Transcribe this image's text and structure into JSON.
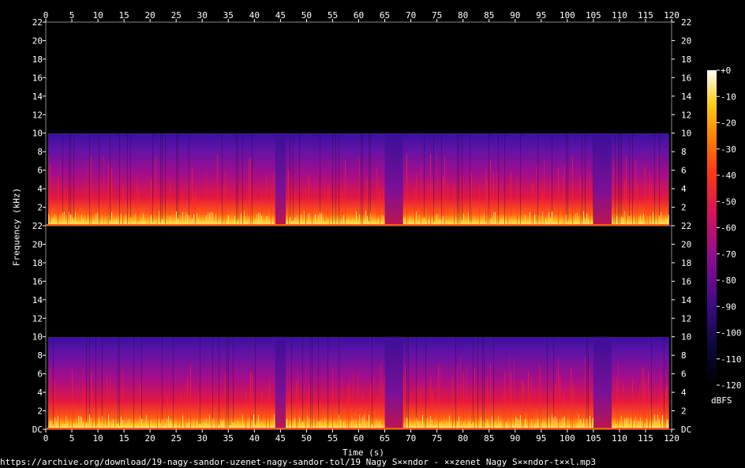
{
  "chart_data": {
    "type": "heatmap",
    "subtype": "spectrogram",
    "channels": 2,
    "xlabel": "Time (s)",
    "ylabel": "Frequency (kHz)",
    "xlim": [
      0,
      120
    ],
    "ylim_khz": [
      0,
      22
    ],
    "x_ticks": [
      "0",
      "5",
      "10",
      "15",
      "20",
      "25",
      "30",
      "35",
      "40",
      "45",
      "50",
      "55",
      "60",
      "65",
      "70",
      "75",
      "80",
      "85",
      "90",
      "95",
      "100",
      "105",
      "110",
      "115",
      "120"
    ],
    "y_ticks_top": [
      "22",
      "20",
      "18",
      "16",
      "14",
      "12",
      "10",
      "8",
      "6",
      "4",
      "2"
    ],
    "y_ticks_bottom": [
      "22",
      "20",
      "18",
      "16",
      "14",
      "12",
      "10",
      "8",
      "6",
      "4",
      "2",
      "DC"
    ],
    "content_cutoff_khz": 10,
    "audio_end_s": 119.5,
    "quiet_segments_s": [
      [
        44,
        46
      ],
      [
        65,
        68.5
      ],
      [
        105,
        108.5
      ]
    ],
    "colorbar": {
      "label": "dBFS",
      "range": [
        -120,
        0
      ],
      "ticks": [
        "+0",
        "-10",
        "-20",
        "-30",
        "-40",
        "-50",
        "-60",
        "-70",
        "-80",
        "-90",
        "-100",
        "-110",
        "-120"
      ]
    },
    "grid": false
  },
  "footer": {
    "source": "https://archive.org/download/19-nagy-sandor-uzenet-nagy-sandor-tol/19 Nagy S××ndor - ××zenet Nagy S××ndor-t××l.mp3"
  }
}
